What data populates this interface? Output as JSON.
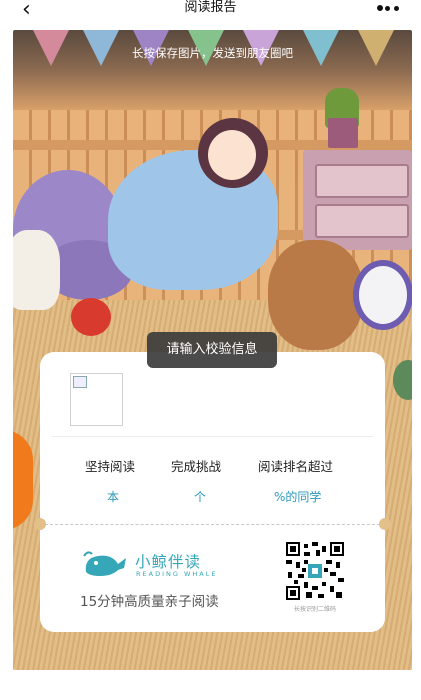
{
  "nav": {
    "back_icon": "chevron-left-icon",
    "title": "阅读报告",
    "more_icon": "more-dots-icon"
  },
  "banner": {
    "hint": "长按保存图片，发送到朋友圈吧"
  },
  "toast": {
    "text": "请输入校验信息"
  },
  "report": {
    "avatar": "broken-image-icon",
    "stats": [
      {
        "label": "坚持阅读",
        "unit": "本"
      },
      {
        "label": "完成挑战",
        "unit": "个"
      },
      {
        "label": "阅读排名超过",
        "unit": "%的同学"
      }
    ],
    "accent_color": "#2a98b8"
  },
  "brand": {
    "name": "小鲸伴读",
    "name_en": "READING WHALE",
    "slogan": "15分钟高质量亲子阅读",
    "color": "#35a7b8"
  },
  "qr": {
    "caption": "长按识别二维码"
  }
}
